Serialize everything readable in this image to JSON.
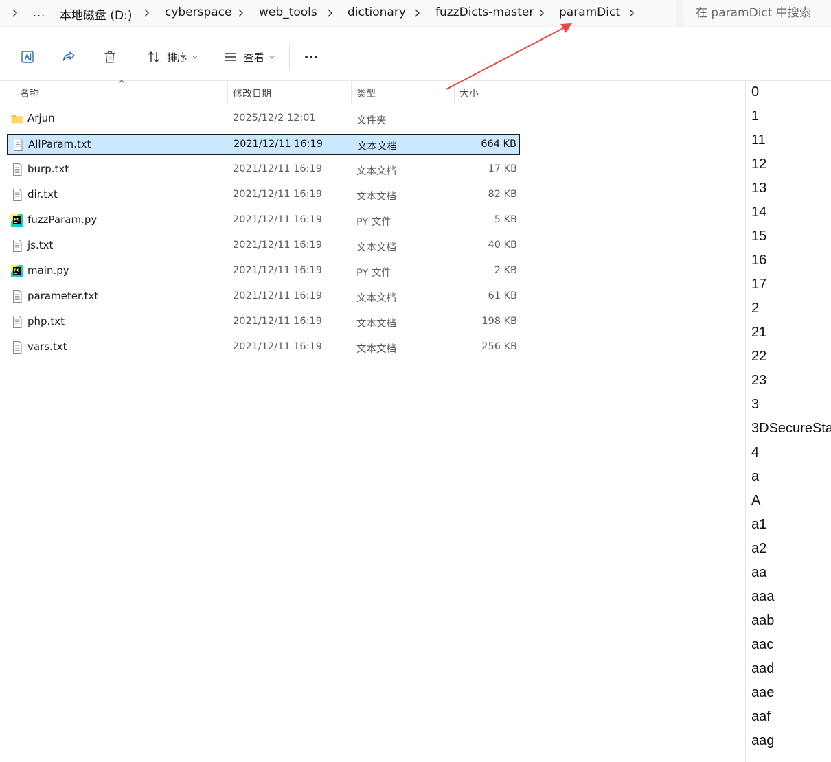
{
  "breadcrumb": {
    "items": [
      "本地磁盘 (D:)",
      "cyberspace",
      "web_tools",
      "dictionary",
      "fuzzDicts-master",
      "paramDict"
    ],
    "more": "..."
  },
  "search": {
    "placeholder": "在 paramDict 中搜索"
  },
  "toolbar": {
    "sort_label": "排序",
    "view_label": "查看",
    "more_label": "..."
  },
  "columns": {
    "name": "名称",
    "modified": "修改日期",
    "type": "类型",
    "size": "大小"
  },
  "files": [
    {
      "name": "Arjun",
      "modified": "2025/12/2 12:01",
      "type": "文件夹",
      "size": "",
      "icon": "folder-icon"
    },
    {
      "name": "AllParam.txt",
      "modified": "2021/12/11 16:19",
      "type": "文本文档",
      "size": "664 KB",
      "icon": "text-file-icon",
      "selected": true
    },
    {
      "name": "burp.txt",
      "modified": "2021/12/11 16:19",
      "type": "文本文档",
      "size": "17 KB",
      "icon": "text-file-icon"
    },
    {
      "name": "dir.txt",
      "modified": "2021/12/11 16:19",
      "type": "文本文档",
      "size": "82 KB",
      "icon": "text-file-icon"
    },
    {
      "name": "fuzzParam.py",
      "modified": "2021/12/11 16:19",
      "type": "PY 文件",
      "size": "5 KB",
      "icon": "pycharm-file-icon"
    },
    {
      "name": "js.txt",
      "modified": "2021/12/11 16:19",
      "type": "文本文档",
      "size": "40 KB",
      "icon": "text-file-icon"
    },
    {
      "name": "main.py",
      "modified": "2021/12/11 16:19",
      "type": "PY 文件",
      "size": "2 KB",
      "icon": "pycharm-file-icon"
    },
    {
      "name": "parameter.txt",
      "modified": "2021/12/11 16:19",
      "type": "文本文档",
      "size": "61 KB",
      "icon": "text-file-icon"
    },
    {
      "name": "php.txt",
      "modified": "2021/12/11 16:19",
      "type": "文本文档",
      "size": "198 KB",
      "icon": "text-file-icon"
    },
    {
      "name": "vars.txt",
      "modified": "2021/12/11 16:19",
      "type": "文本文档",
      "size": "256 KB",
      "icon": "text-file-icon"
    }
  ],
  "preview": {
    "lines": [
      "0",
      "1",
      "11",
      "12",
      "13",
      "14",
      "15",
      "16",
      "17",
      "2",
      "21",
      "22",
      "23",
      "3",
      "3DSecureSta",
      "4",
      "a",
      "A",
      "a1",
      "a2",
      "aa",
      "aaa",
      "aab",
      "aac",
      "aad",
      "aae",
      "aaf",
      "aag"
    ]
  },
  "colors": {
    "selection_bg": "#cce8ff",
    "annotation_arrow": "#e5484d",
    "folder": "#f4c02f"
  }
}
